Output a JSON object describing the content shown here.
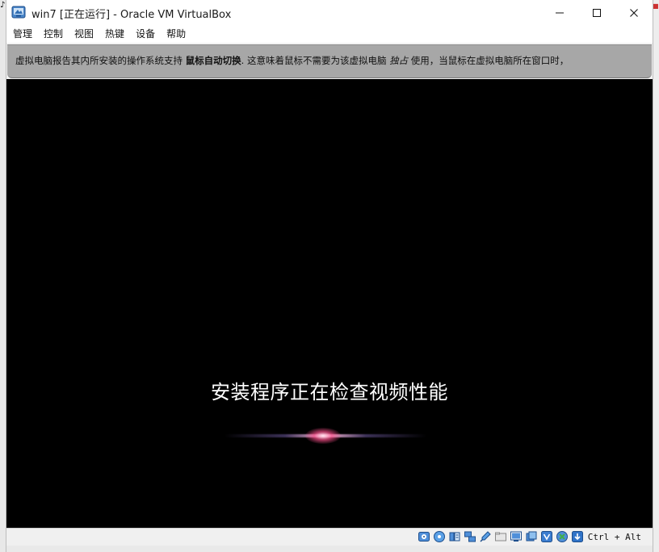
{
  "window": {
    "title": "win7 [正在运行] - Oracle VM VirtualBox",
    "icon": "virtualbox-icon"
  },
  "menubar": {
    "items": [
      {
        "label": "管理"
      },
      {
        "label": "控制"
      },
      {
        "label": "视图"
      },
      {
        "label": "热键"
      },
      {
        "label": "设备"
      },
      {
        "label": "帮助"
      }
    ]
  },
  "notice": {
    "part1": "虚拟电脑报告其内所安装的操作系统支持",
    "bold": "鼠标自动切换",
    "part2": ". 这意味着鼠标不需要为该虚拟电脑",
    "italic": "独占",
    "part3": "使用，当鼠标在虚拟电脑所在窗口时，"
  },
  "screen": {
    "message": "安装程序正在检查视频性能"
  },
  "statusbar": {
    "icons": [
      "hard-disk-icon",
      "optical-drive-icon",
      "audio-icon",
      "network-icon",
      "usb-icon",
      "shared-folders-icon",
      "display-icon",
      "video-capture-icon",
      "virtualization-icon",
      "mouse-integration-icon",
      "keyboard-capture-icon"
    ],
    "host_key": "Ctrl + Alt"
  },
  "colors": {
    "screen_bg": "#000000",
    "notice_bg": "#a7a7a7",
    "accent_blue": "#1f6fd1"
  }
}
